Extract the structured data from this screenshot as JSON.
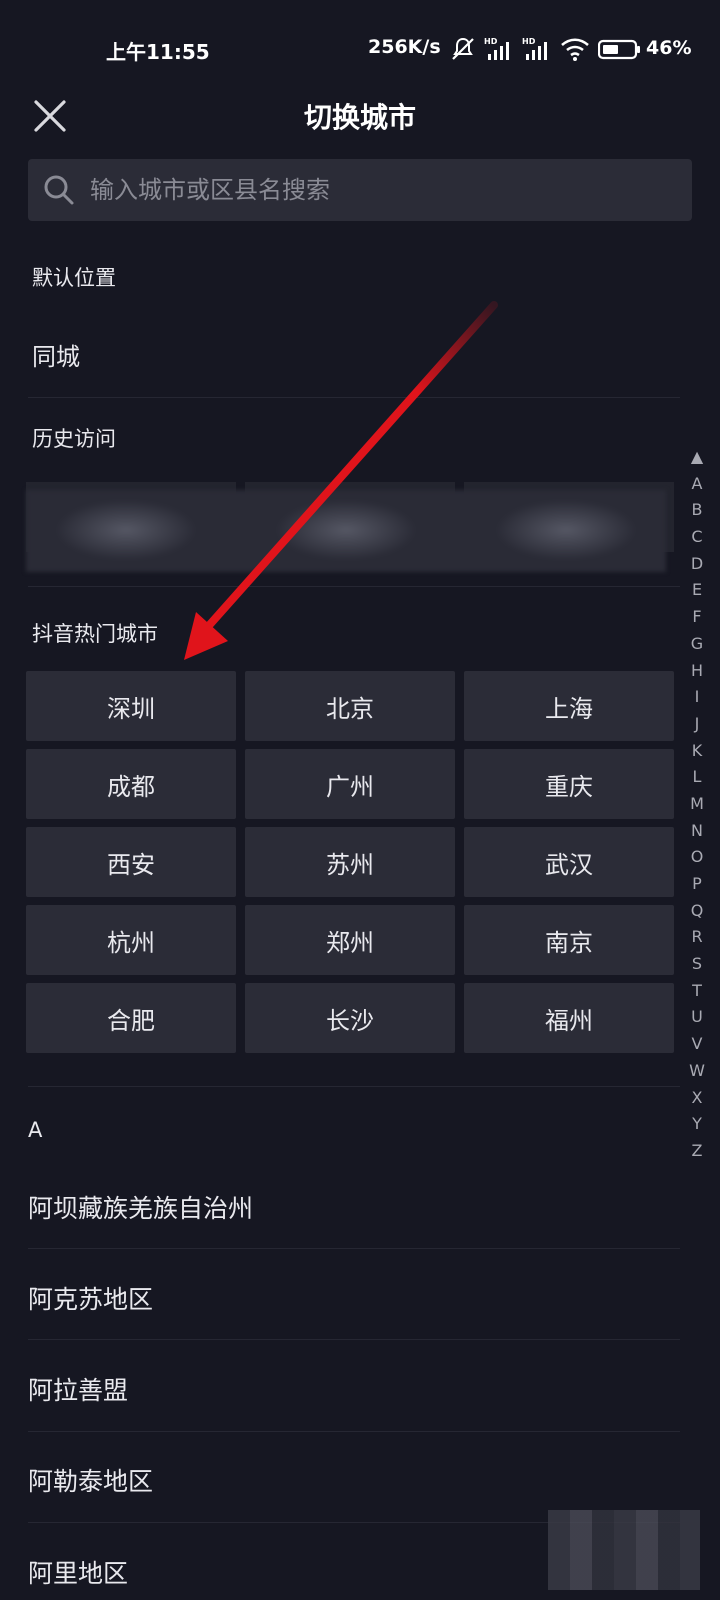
{
  "status": {
    "time": "上午11:55",
    "speed": "256K/s",
    "battery": "46%",
    "icons": [
      "mute-icon",
      "hd-signal-icon",
      "hd-signal-icon",
      "wifi-icon",
      "battery-icon"
    ]
  },
  "header": {
    "title": "切换城市",
    "close_icon": "close-icon"
  },
  "search": {
    "placeholder": "输入城市或区县名搜索",
    "value": ""
  },
  "sections": {
    "default_label": "默认位置",
    "default_item": "同城",
    "history_label": "历史访问",
    "hot_label": "抖音热门城市"
  },
  "hot_cities": [
    "深圳",
    "北京",
    "上海",
    "成都",
    "广州",
    "重庆",
    "西安",
    "苏州",
    "武汉",
    "杭州",
    "郑州",
    "南京",
    "合肥",
    "长沙",
    "福州"
  ],
  "list": {
    "letter": "A",
    "cities": [
      "阿坝藏族羌族自治州",
      "阿克苏地区",
      "阿拉善盟",
      "阿勒泰地区",
      "阿里地区"
    ]
  },
  "alpha_index": [
    "▲",
    "A",
    "B",
    "C",
    "D",
    "E",
    "F",
    "G",
    "H",
    "I",
    "J",
    "K",
    "L",
    "M",
    "N",
    "O",
    "P",
    "Q",
    "R",
    "S",
    "T",
    "U",
    "V",
    "W",
    "X",
    "Y",
    "Z"
  ],
  "colors": {
    "background": "#161722",
    "tile": "#2b2c37",
    "annotation_arrow": "#e0141b"
  }
}
